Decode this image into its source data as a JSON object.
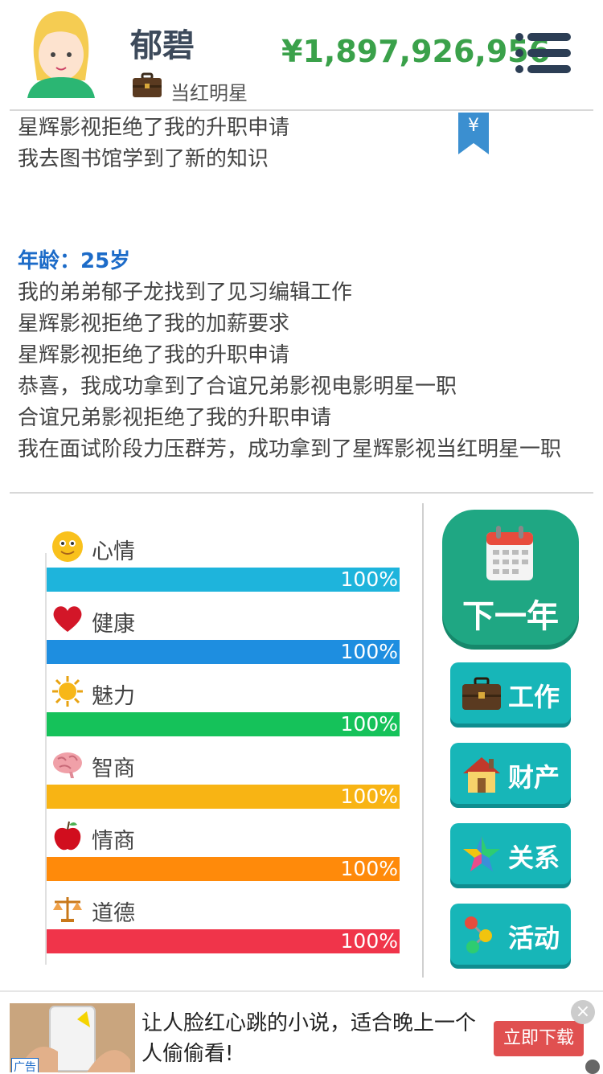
{
  "header": {
    "name": "郁碧",
    "job_title": "当红明星",
    "money": "¥1,897,926,956"
  },
  "log": {
    "lines_prev": [
      "星辉影视拒绝了我的升职申请",
      "我去图书馆学到了新的知识"
    ],
    "bookmark_symbol": "¥",
    "age_label": "年龄：25岁",
    "lines": [
      "我的弟弟郁子龙找到了见习编辑工作",
      "星辉影视拒绝了我的加薪要求",
      "星辉影视拒绝了我的升职申请",
      "恭喜，我成功拿到了合谊兄弟影视电影明星一职",
      "合谊兄弟影视拒绝了我的升职申请",
      "我在面试阶段力压群芳，成功拿到了星辉影视当红明星一职"
    ]
  },
  "stats": [
    {
      "label": "心情",
      "value": 1.0,
      "text": "100%",
      "color": "#1eb4dc",
      "icon": "smiley-icon"
    },
    {
      "label": "健康",
      "value": 1.0,
      "text": "100%",
      "color": "#1e8ee0",
      "icon": "heart-icon"
    },
    {
      "label": "魅力",
      "value": 1.0,
      "text": "100%",
      "color": "#15c25a",
      "icon": "sun-icon"
    },
    {
      "label": "智商",
      "value": 1.0,
      "text": "100%",
      "color": "#f8b414",
      "icon": "brain-icon"
    },
    {
      "label": "情商",
      "value": 1.0,
      "text": "100%",
      "color": "#ff8a0a",
      "icon": "apple-icon"
    },
    {
      "label": "道德",
      "value": 1.0,
      "text": "100%",
      "color": "#f0344a",
      "icon": "scales-icon"
    }
  ],
  "actions": {
    "next_year": "下一年",
    "work": "工作",
    "assets": "财产",
    "relations": "关系",
    "activities": "活动"
  },
  "ad": {
    "text": "让人脸红心跳的小说，适合晚上一个人偷偷看!",
    "button": "立即下载",
    "tag": "广告",
    "close": "×"
  }
}
